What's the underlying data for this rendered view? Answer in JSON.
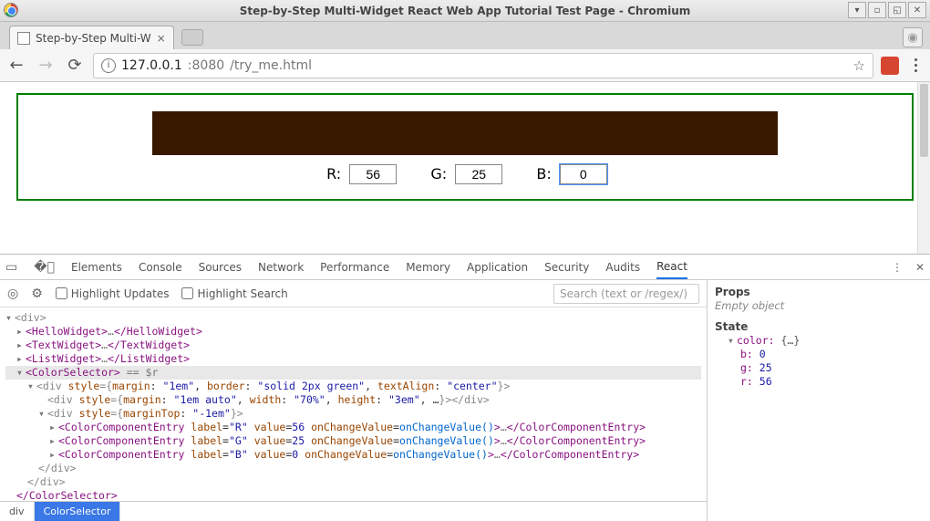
{
  "window": {
    "title": "Step-by-Step Multi-Widget React Web App Tutorial Test Page - Chromium"
  },
  "tab": {
    "title": "Step-by-Step Multi-W"
  },
  "url": {
    "host": "127.0.0.1",
    "port": ":8080",
    "path": "/try_me.html"
  },
  "app": {
    "labels": {
      "r": "R:",
      "g": "G:",
      "b": "B:"
    },
    "values": {
      "r": "56",
      "g": "25",
      "b": "0"
    },
    "focused": "b"
  },
  "devtools": {
    "tabs": [
      "Elements",
      "Console",
      "Sources",
      "Network",
      "Performance",
      "Memory",
      "Application",
      "Security",
      "Audits",
      "React"
    ],
    "active_tab": "React",
    "subbar": {
      "highlight_updates": "Highlight Updates",
      "highlight_search": "Highlight Search",
      "search_placeholder": "Search (text or /regex/)"
    },
    "tree": {
      "root_open": "<div>",
      "hello": {
        "open": "<HelloWidget>",
        "mid": "…",
        "close": "</HelloWidget>"
      },
      "text": {
        "open": "<TextWidget>",
        "mid": "…",
        "close": "</TextWidget>"
      },
      "list": {
        "open": "<ListWidget>",
        "mid": "…",
        "close": "</ListWidget>"
      },
      "colorselector": {
        "open": "<ColorSelector>",
        "suffix": " == $r",
        "close": "</ColorSelector>"
      },
      "outer_div": "<div style={margin: \"1em\", border: \"solid 2px green\", textAlign: \"center\"}>",
      "bar_div": "<div style={margin: \"1em auto\", width: \"70%\", height: \"3em\", …}></div>",
      "inner_div": "<div style={marginTop: \"-1em\"}>",
      "cce_r": "<ColorComponentEntry label=\"R\" value=56 onChangeValue=onChangeValue()>…</ColorComponentEntry>",
      "cce_g": "<ColorComponentEntry label=\"G\" value=25 onChangeValue=onChangeValue()>…</ColorComponentEntry>",
      "cce_b": "<ColorComponentEntry label=\"B\" value=0 onChangeValue=onChangeValue()>…</ColorComponentEntry>",
      "div_close": "</div>",
      "root_close": "</div>"
    },
    "breadcrumb": [
      "div",
      "ColorSelector"
    ],
    "side": {
      "props_header": "Props",
      "props_empty": "Empty object",
      "state_header": "State",
      "color_label": "color:",
      "color_val": "{…}",
      "b": {
        "k": "b:",
        "v": "0"
      },
      "g": {
        "k": "g:",
        "v": "25"
      },
      "r": {
        "k": "r:",
        "v": "56"
      }
    }
  }
}
